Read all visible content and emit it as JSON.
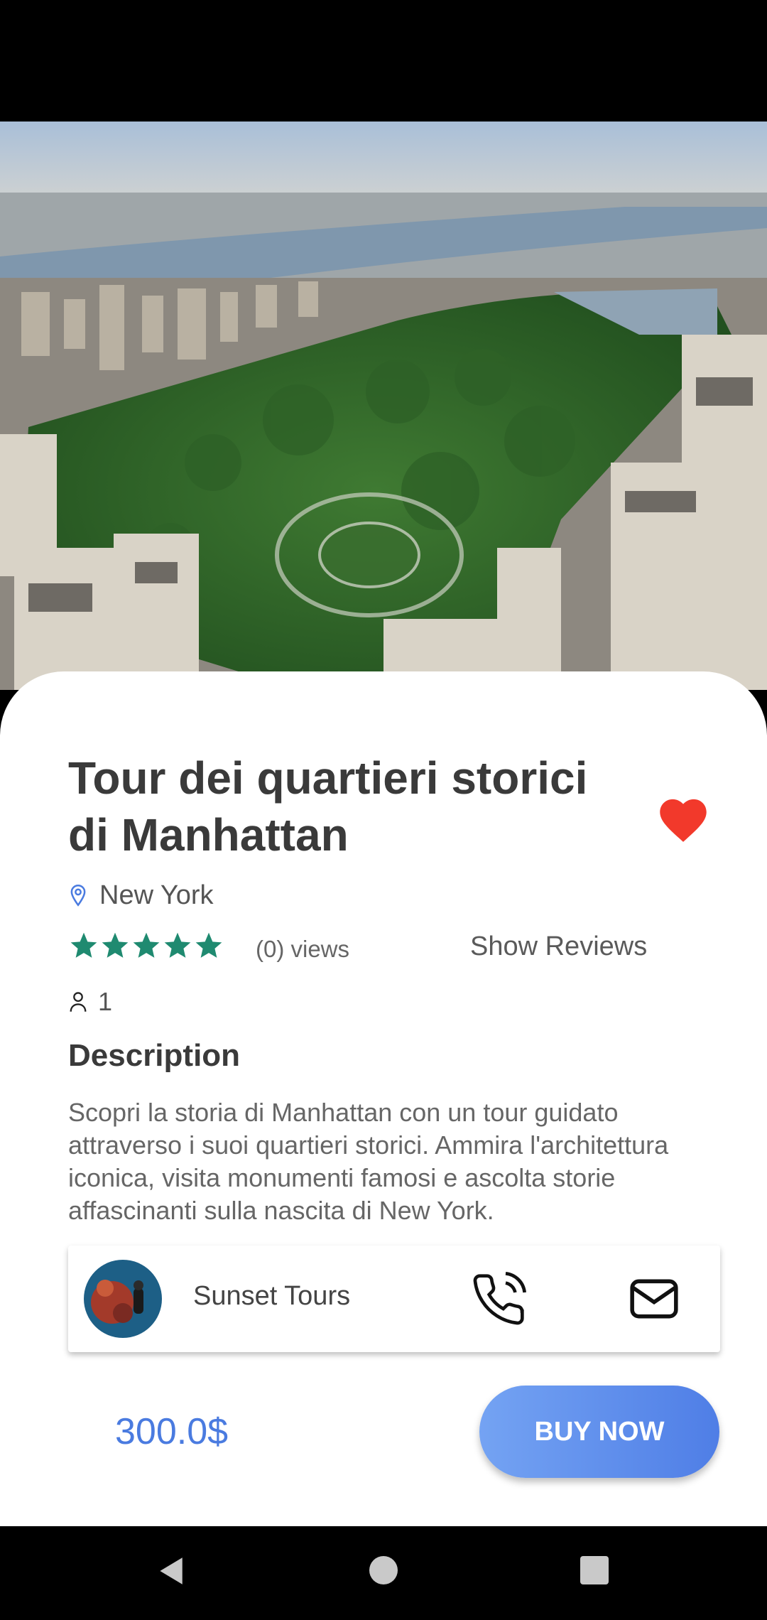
{
  "tour": {
    "title": "Tour dei quartieri storici di Manhattan",
    "location": "New York",
    "views_label": "(0) views",
    "show_reviews_label": "Show Reviews",
    "participants": "1",
    "description_heading": "Description",
    "description": "Scopri la storia di Manhattan con un tour guidato attraverso i suoi quartieri storici. Ammira l'architettura iconica, visita monumenti famosi e ascolta storie affascinanti sulla nascita di New York.",
    "rating": 5,
    "favorite": true
  },
  "operator": {
    "name": "Sunset Tours"
  },
  "purchase": {
    "price": "300.0$",
    "buy_label": "BUY NOW"
  },
  "colors": {
    "accent": "#4a7be0",
    "star": "#1f8a70",
    "heart": "#f2392b"
  },
  "icons": {
    "favorite": "heart-icon",
    "location": "location-pin-icon",
    "rating": "star-icon",
    "participants": "person-icon",
    "call": "phone-icon",
    "email": "mail-icon"
  }
}
